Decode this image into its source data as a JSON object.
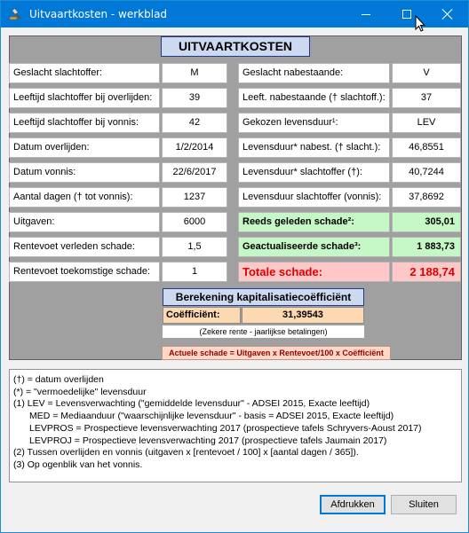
{
  "window": {
    "title": "Uitvaartkosten - werkblad"
  },
  "header": {
    "title": "UITVAARTKOSTEN"
  },
  "left_rows": [
    {
      "label": "Geslacht slachtoffer:",
      "value": "M"
    },
    {
      "label": "Leeftijd slachtoffer bij overlijden:",
      "value": "39"
    },
    {
      "label": "Leeftijd slachtoffer bij vonnis:",
      "value": "42"
    },
    {
      "label": "Datum overlijden:",
      "value": "1/2/2014"
    },
    {
      "label": "Datum vonnis:",
      "value": "22/6/2017"
    },
    {
      "label": "Aantal dagen († tot vonnis):",
      "value": "1237"
    },
    {
      "label": "Uitgaven:",
      "value": "6000"
    },
    {
      "label": "Rentevoet verleden schade:",
      "value": "1,5"
    },
    {
      "label": "Rentevoet toekomstige schade:",
      "value": "1"
    }
  ],
  "right_rows": [
    {
      "label": "Geslacht nabestaande:",
      "value": "V"
    },
    {
      "label": "Leeft. nabestaande († slachtoff.):",
      "value": "37"
    },
    {
      "label": "Gekozen levensduur¹:",
      "value": "LEV"
    },
    {
      "label": "Levensduur* nabest. († slacht.):",
      "value": "46,8551"
    },
    {
      "label": "Levensduur* slachtoffer (†):",
      "value": "40,7244"
    },
    {
      "label": "Levensduur slachtoffer (vonnis):",
      "value": "37,8692"
    },
    {
      "label": "Reeds geleden schade²:",
      "value": "305,01"
    },
    {
      "label": "Geactualiseerde schade³:",
      "value": "1 883,73"
    },
    {
      "label": "Totale schade:",
      "value": "2 188,74"
    }
  ],
  "coefficient": {
    "title": "Berekening kapitalisatiecoëfficiënt",
    "label": "Coëfficiënt:",
    "value": "31,39543",
    "note": "(Zekere rente - jaarlijkse betalingen)"
  },
  "formula": "Actuele schade = Uitgaven x Rentevoet/100 x Coëfficiënt",
  "notes": [
    "(†) = datum overlijden",
    "(*) = \"vermoedelijke\" levensduur",
    "(1) LEV = Levensverwachting (\"gemiddelde levensduur\" - ADSEI 2015, Exacte leeftijd)",
    "MED = Mediaanduur (\"waarschijnlijke levensduur\" - basis = ADSEI 2015, Exacte leeftijd)",
    "LEVPROS = Prospectieve levensverwachting 2017 (prospectieve tafels Schryvers-Aoust 2017)",
    "LEVPROJ = Prospectieve levensverwachting 2017 (prospectieve tafels Jaumain 2017)",
    "(2) Tussen overlijden en vonnis (uitgaven x [rentevoet / 100] x [aantal dagen / 365]).",
    "(3) Op ogenblik van het vonnis."
  ],
  "buttons": {
    "print": "Afdrukken",
    "close": "Sluiten"
  },
  "colors": {
    "titlebar": "#0078d7",
    "header_bg": "#ccd9f0",
    "green": "#c6f7c6",
    "red": "#ffc8c8",
    "total_text": "#e00000",
    "coef_bg": "#fcd9b0"
  },
  "icons": {
    "app": "gavel-icon",
    "minimize": "minimize-icon",
    "maximize": "maximize-icon",
    "close": "close-icon",
    "cursor": "mouse-cursor-icon"
  }
}
